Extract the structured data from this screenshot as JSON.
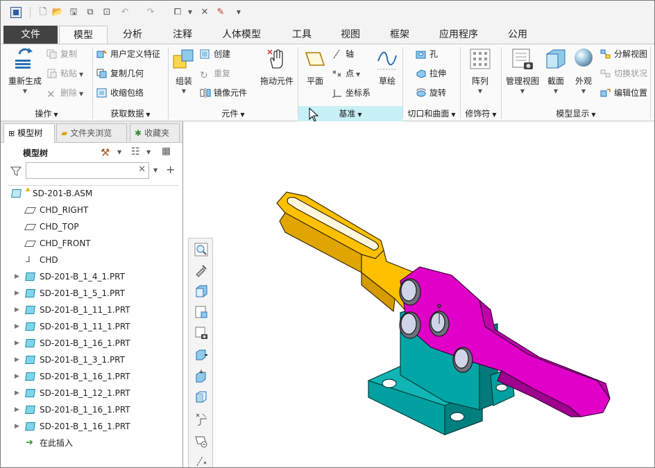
{
  "tabs": [
    {
      "label": "文件"
    },
    {
      "label": "模型"
    },
    {
      "label": "分析"
    },
    {
      "label": "注释"
    },
    {
      "label": "人体模型"
    },
    {
      "label": "工具"
    },
    {
      "label": "视图"
    },
    {
      "label": "框架"
    },
    {
      "label": "应用程序"
    },
    {
      "label": "公用"
    }
  ],
  "ribbon": {
    "operations": {
      "regen": "重新生成",
      "copy": "复制",
      "paste": "粘贴",
      "delete": "删除",
      "group": "操作"
    },
    "get_data": {
      "udf": "用户定义特征",
      "copy_geom": "复制几何",
      "shrinkwrap": "收缩包络",
      "group": "获取数据"
    },
    "component": {
      "assemble": "组装",
      "create": "创建",
      "repeat": "重复",
      "mirror": "镜像元件",
      "drag": "拖动元件",
      "group": "元件"
    },
    "datum": {
      "plane": "平面",
      "axis": "轴",
      "point": "点",
      "csys": "坐标系",
      "sketch": "草绘",
      "group": "基准"
    },
    "cut_surface": {
      "hole": "孔",
      "extrude": "拉伸",
      "revolve": "旋转",
      "group": "切口和曲面"
    },
    "modifiers": {
      "pattern": "阵列",
      "group": "修饰符"
    },
    "model_display": {
      "manage_views": "管理视图",
      "section": "截面",
      "appearance": "外观",
      "explode": "分解视图",
      "toggle_status": "切换状况",
      "edit_position": "编辑位置",
      "group": "模型显示"
    }
  },
  "panel": {
    "tabs": [
      {
        "label": "模型树"
      },
      {
        "label": "文件夹浏览"
      },
      {
        "label": "收藏夹"
      }
    ],
    "title": "模型树",
    "filter_placeholder": ""
  },
  "tree": [
    {
      "label": "SD-201-B.ASM",
      "icon": "assembly-icon"
    },
    {
      "label": "CHD_RIGHT",
      "icon": "datum-plane-icon"
    },
    {
      "label": "CHD_TOP",
      "icon": "datum-plane-icon"
    },
    {
      "label": "CHD_FRONT",
      "icon": "datum-plane-icon"
    },
    {
      "label": "CHD",
      "icon": "csys-icon"
    },
    {
      "label": "SD-201-B_1_4_1.PRT",
      "icon": "part-icon"
    },
    {
      "label": "SD-201-B_1_5_1.PRT",
      "icon": "part-icon"
    },
    {
      "label": "SD-201-B_1_11_1.PRT",
      "icon": "part-icon"
    },
    {
      "label": "SD-201-B_1_11_1.PRT",
      "icon": "part-icon"
    },
    {
      "label": "SD-201-B_1_16_1.PRT",
      "icon": "part-icon"
    },
    {
      "label": "SD-201-B_1_3_1.PRT",
      "icon": "part-icon"
    },
    {
      "label": "SD-201-B_1_16_1.PRT",
      "icon": "part-icon"
    },
    {
      "label": "SD-201-B_1_12_1.PRT",
      "icon": "part-icon"
    },
    {
      "label": "SD-201-B_1_16_1.PRT",
      "icon": "part-icon"
    },
    {
      "label": "SD-201-B_1_16_1.PRT",
      "icon": "part-icon"
    },
    {
      "label": "在此插入",
      "icon": "insert-here-icon"
    }
  ],
  "colors": {
    "handle": "#ffc000",
    "lever": "#e000c8",
    "base": "#00a0a0",
    "file_tab": "#424242",
    "datum_highlight": "#c8f0f7"
  }
}
